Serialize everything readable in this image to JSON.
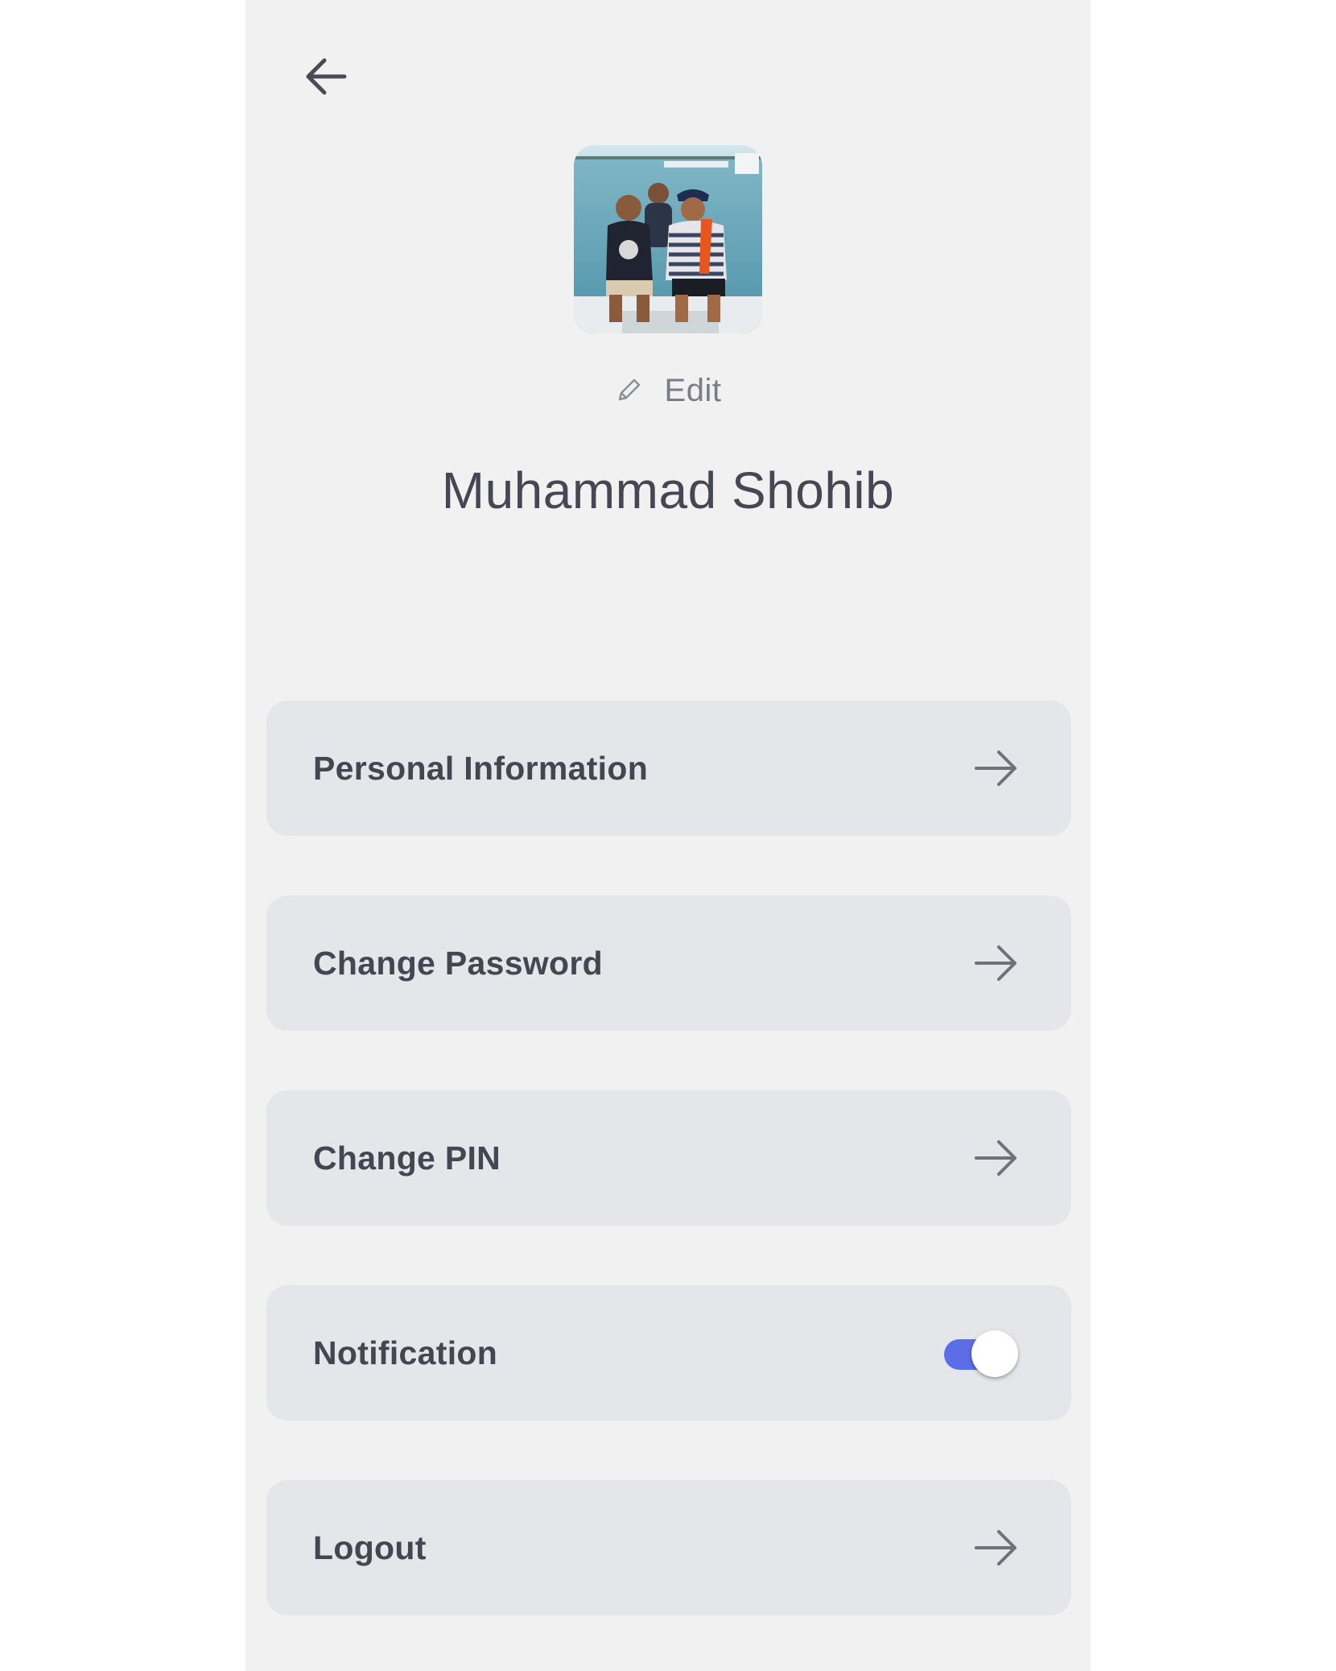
{
  "header": {
    "back_icon": "arrow-left-icon"
  },
  "profile": {
    "edit_label": "Edit",
    "edit_icon": "pencil-icon",
    "name": "Muhammad Shohib"
  },
  "menu": {
    "items": [
      {
        "label": "Personal Information",
        "icon": "arrow-right-icon"
      },
      {
        "label": "Change Password",
        "icon": "arrow-right-icon"
      },
      {
        "label": "Change PIN",
        "icon": "arrow-right-icon"
      },
      {
        "label": "Notification",
        "toggle_on": true
      },
      {
        "label": "Logout",
        "icon": "arrow-right-icon"
      }
    ]
  },
  "colors": {
    "background": "#f1f1f2",
    "card": "#e5e6ea",
    "text": "#454652",
    "accent": "#5b6ee8"
  }
}
